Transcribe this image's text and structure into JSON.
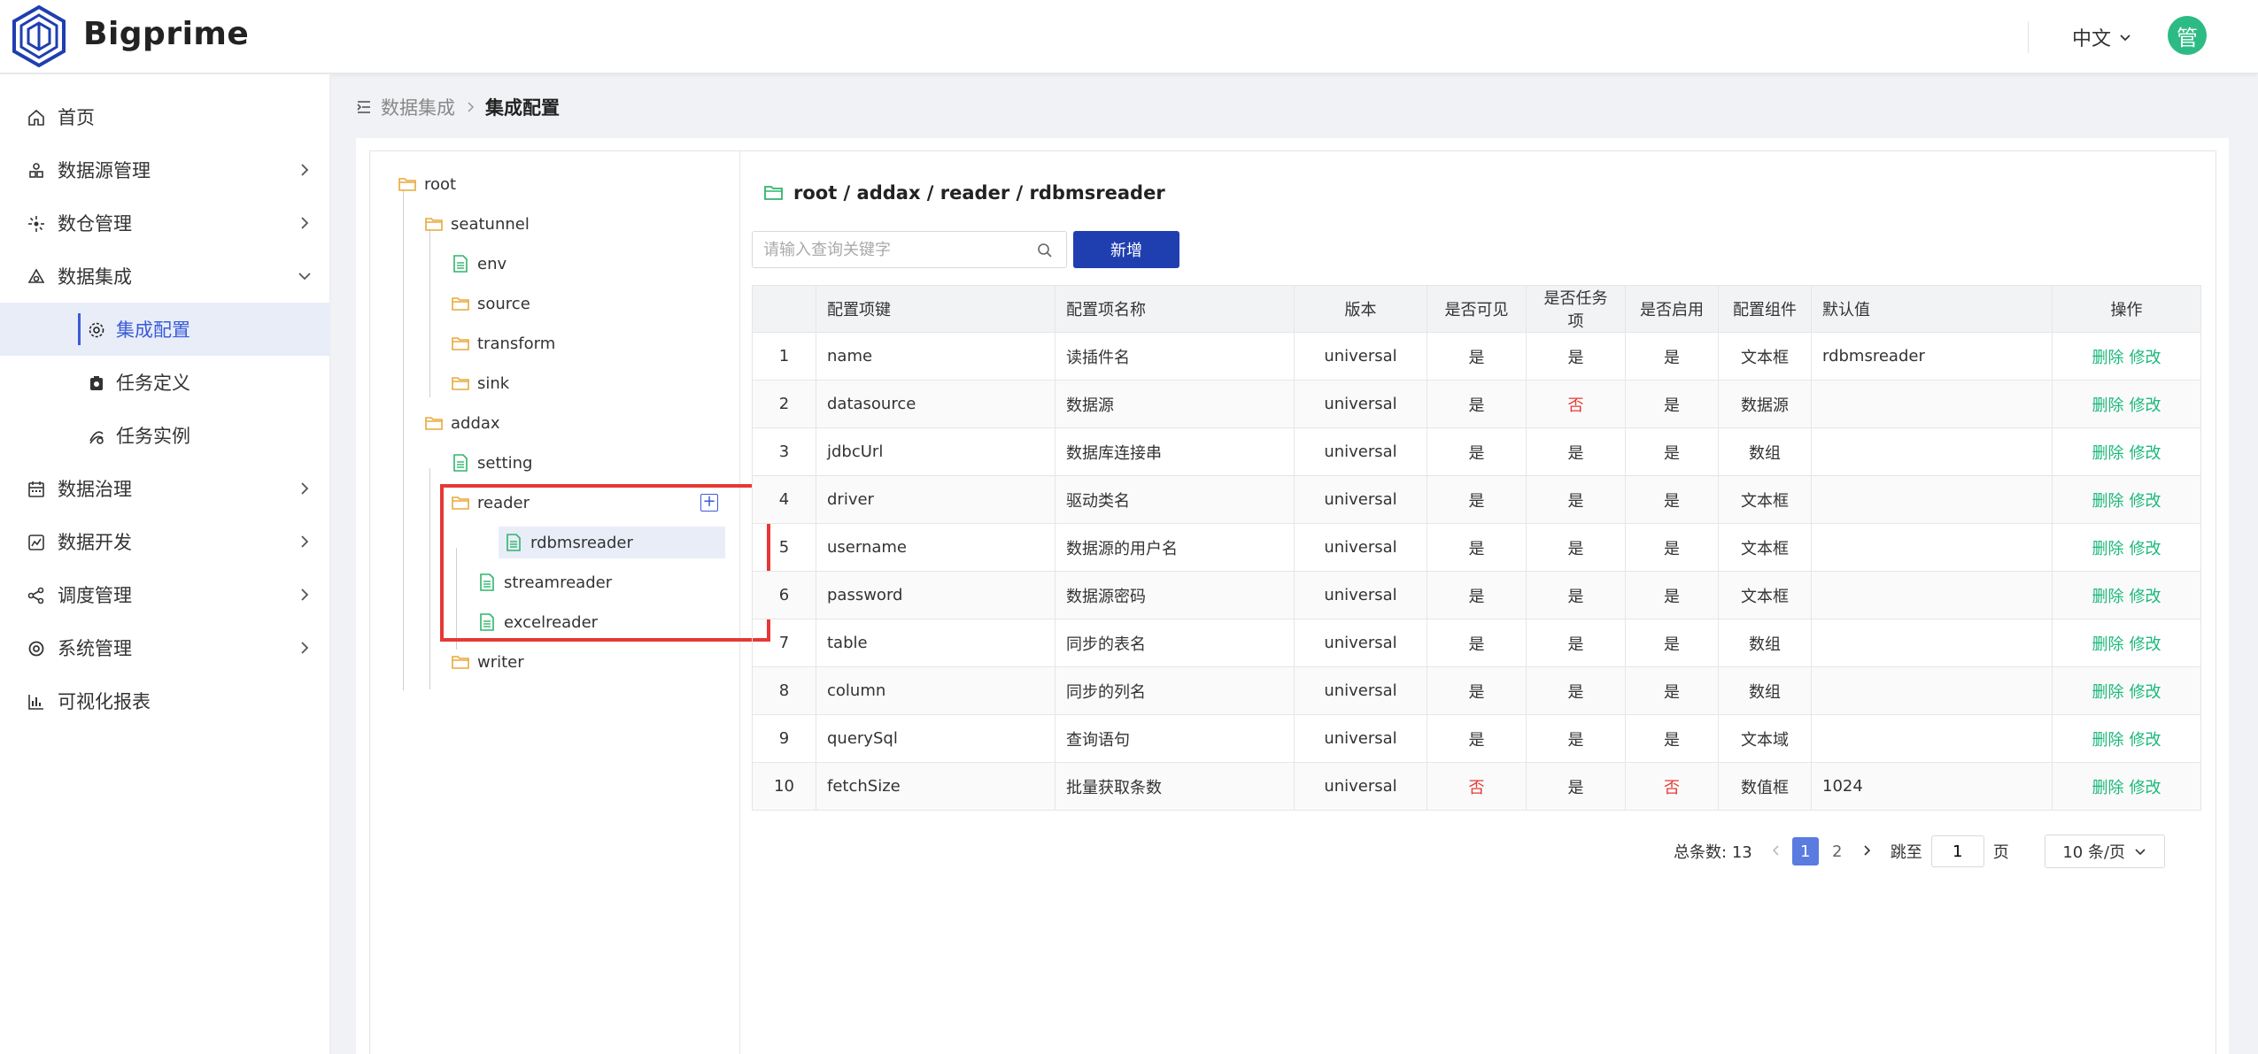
{
  "app": {
    "brand": "Bigprime",
    "language": "中文",
    "user_initial": "管"
  },
  "sidebar": {
    "items": [
      {
        "label": "首页"
      },
      {
        "label": "数据源管理"
      },
      {
        "label": "数仓管理"
      },
      {
        "label": "数据集成"
      },
      {
        "label": "集成配置"
      },
      {
        "label": "任务定义"
      },
      {
        "label": "任务实例"
      },
      {
        "label": "数据治理"
      },
      {
        "label": "数据开发"
      },
      {
        "label": "调度管理"
      },
      {
        "label": "系统管理"
      },
      {
        "label": "可视化报表"
      }
    ]
  },
  "breadcrumb": {
    "parent": "数据集成",
    "current": "集成配置"
  },
  "tree": {
    "nodes": [
      {
        "label": "root"
      },
      {
        "label": "seatunnel"
      },
      {
        "label": "env"
      },
      {
        "label": "source"
      },
      {
        "label": "transform"
      },
      {
        "label": "sink"
      },
      {
        "label": "addax"
      },
      {
        "label": "setting"
      },
      {
        "label": "reader"
      },
      {
        "label": "rdbmsreader"
      },
      {
        "label": "streamreader"
      },
      {
        "label": "excelreader"
      },
      {
        "label": "writer"
      }
    ]
  },
  "main": {
    "path": "root / addax / reader / rdbmsreader",
    "search_placeholder": "请输入查询关键字",
    "add_label": "新增"
  },
  "table": {
    "headers": [
      "",
      "配置项键",
      "配置项名称",
      "版本",
      "是否可见",
      "是否任务项",
      "是否启用",
      "配置组件",
      "默认值",
      "操作"
    ],
    "delete_label": "删除",
    "edit_label": "修改",
    "rows": [
      {
        "idx": "1",
        "key": "name",
        "name": "读插件名",
        "version": "universal",
        "visible": "是",
        "task": "是",
        "enabled": "是",
        "component": "文本框",
        "default": "rdbmsreader"
      },
      {
        "idx": "2",
        "key": "datasource",
        "name": "数据源",
        "version": "universal",
        "visible": "是",
        "task": "否",
        "enabled": "是",
        "component": "数据源",
        "default": ""
      },
      {
        "idx": "3",
        "key": "jdbcUrl",
        "name": "数据库连接串",
        "version": "universal",
        "visible": "是",
        "task": "是",
        "enabled": "是",
        "component": "数组",
        "default": ""
      },
      {
        "idx": "4",
        "key": "driver",
        "name": "驱动类名",
        "version": "universal",
        "visible": "是",
        "task": "是",
        "enabled": "是",
        "component": "文本框",
        "default": ""
      },
      {
        "idx": "5",
        "key": "username",
        "name": "数据源的用户名",
        "version": "universal",
        "visible": "是",
        "task": "是",
        "enabled": "是",
        "component": "文本框",
        "default": ""
      },
      {
        "idx": "6",
        "key": "password",
        "name": "数据源密码",
        "version": "universal",
        "visible": "是",
        "task": "是",
        "enabled": "是",
        "component": "文本框",
        "default": ""
      },
      {
        "idx": "7",
        "key": "table",
        "name": "同步的表名",
        "version": "universal",
        "visible": "是",
        "task": "是",
        "enabled": "是",
        "component": "数组",
        "default": ""
      },
      {
        "idx": "8",
        "key": "column",
        "name": "同步的列名",
        "version": "universal",
        "visible": "是",
        "task": "是",
        "enabled": "是",
        "component": "数组",
        "default": ""
      },
      {
        "idx": "9",
        "key": "querySql",
        "name": "查询语句",
        "version": "universal",
        "visible": "是",
        "task": "是",
        "enabled": "是",
        "component": "文本域",
        "default": ""
      },
      {
        "idx": "10",
        "key": "fetchSize",
        "name": "批量获取条数",
        "version": "universal",
        "visible": "否",
        "task": "是",
        "enabled": "否",
        "component": "数值框",
        "default": "1024"
      }
    ]
  },
  "pagination": {
    "total_label": "总条数:",
    "total": "13",
    "pages": [
      "1",
      "2"
    ],
    "current": "1",
    "jump_label": "跳至",
    "jump_value": "1",
    "page_unit": "页",
    "page_size": "10 条/页"
  },
  "colors": {
    "accent": "#3a5bd8",
    "primary_button": "#1f3fb0",
    "action_link": "#1bb87a",
    "negative": "#e53935",
    "highlight_box": "#e53935"
  }
}
